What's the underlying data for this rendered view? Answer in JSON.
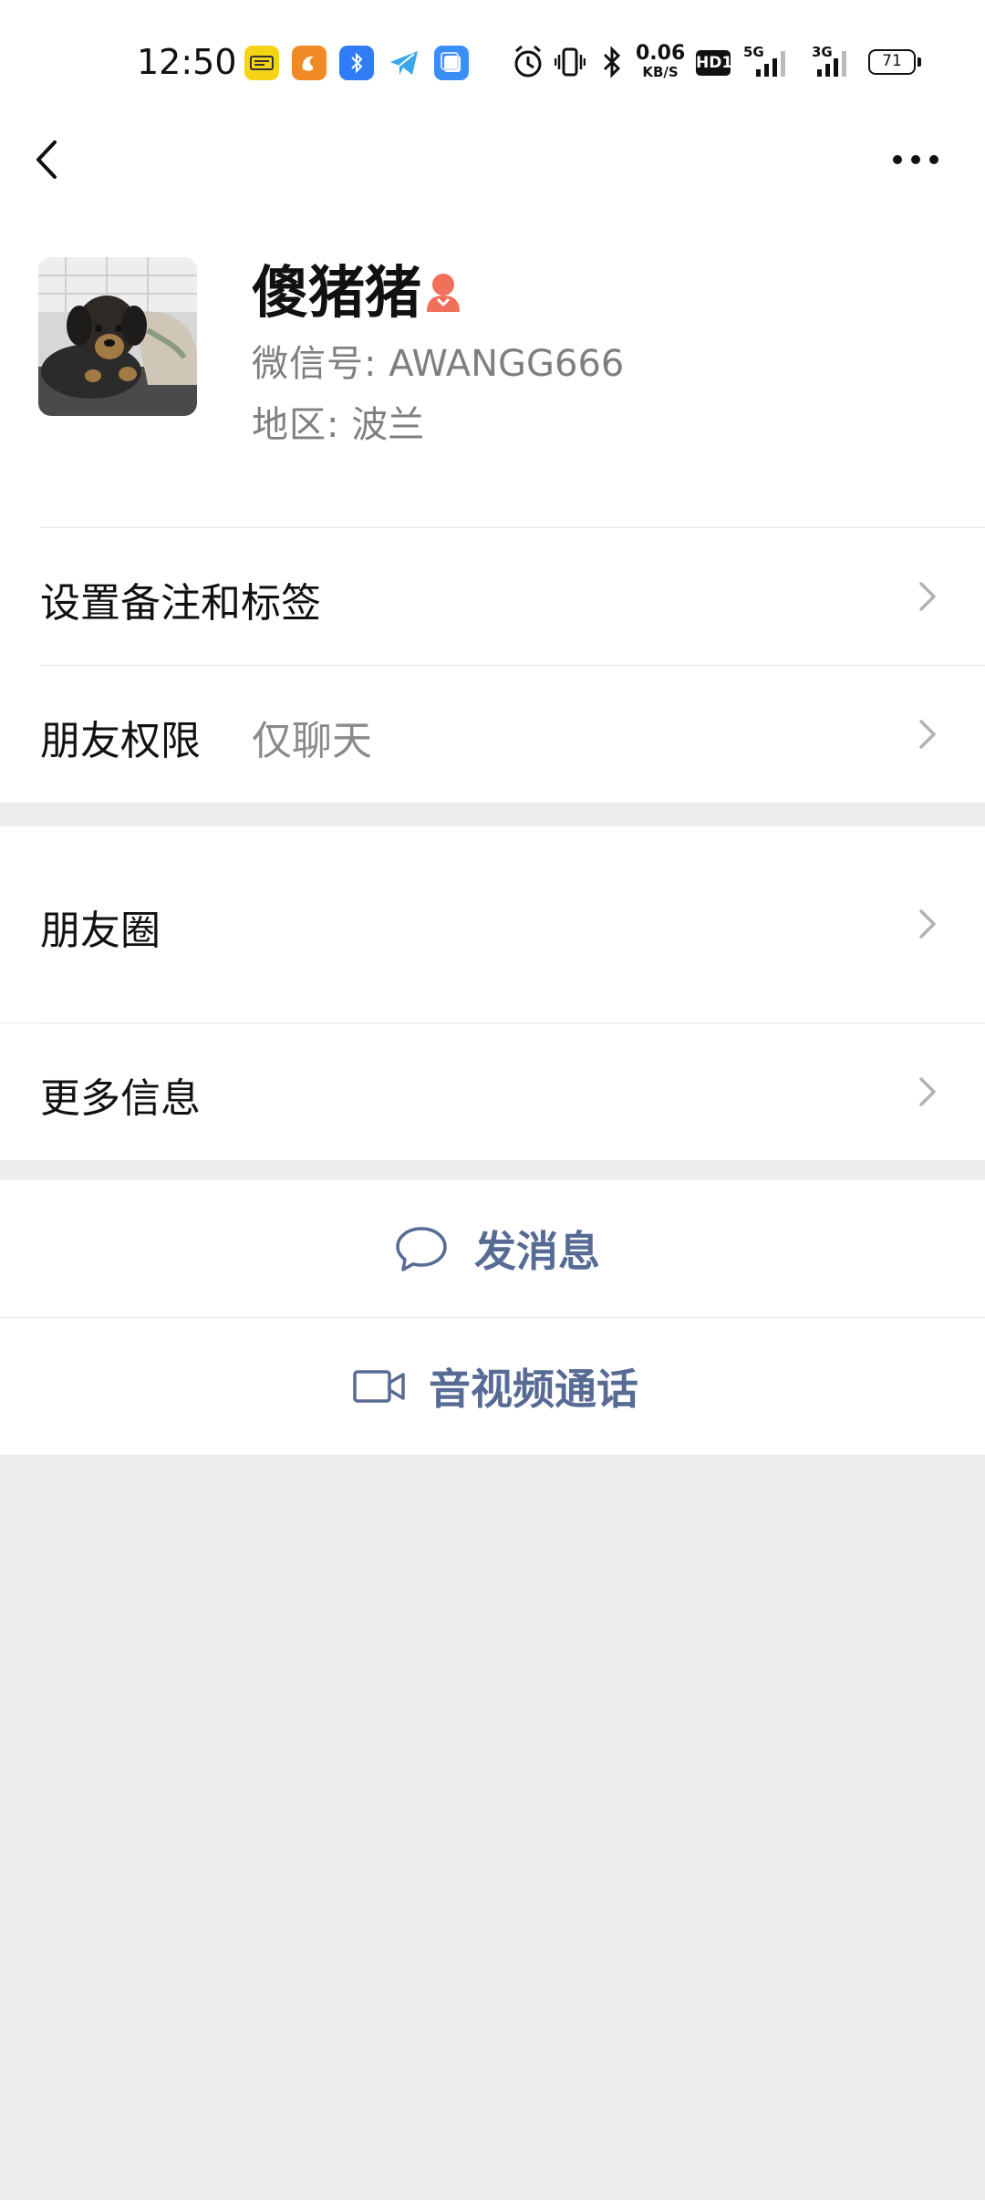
{
  "status_bar": {
    "time": "12:50",
    "net_speed_value": "0.06",
    "net_speed_unit": "KB/S",
    "hd_label": "HD1",
    "signal1_tag": "5G",
    "signal2_tag": "3G",
    "battery_level": "71",
    "app_icons": [
      "news-app-icon",
      "uc-browser-icon",
      "bluetooth-app-icon",
      "telegram-icon",
      "window-app-icon"
    ],
    "colors": {
      "news": "#f5d315",
      "uc": "#f08a24",
      "bt": "#2f7cf6",
      "telegram": "#37a7e8",
      "window": "#3a8ef6"
    }
  },
  "profile": {
    "name": "傻猪猪",
    "wechat_id_label": "微信号:",
    "wechat_id_value": "AWANGG666",
    "region_label": "地区:",
    "region_value": "波兰",
    "gender_color": "#f0705a"
  },
  "rows": {
    "remark_tags": {
      "label": "设置备注和标签"
    },
    "permissions": {
      "label": "朋友权限",
      "value": "仅聊天"
    },
    "moments": {
      "label": "朋友圈"
    },
    "more_info": {
      "label": "更多信息"
    }
  },
  "actions": {
    "message": {
      "label": "发消息"
    },
    "call": {
      "label": "音视频通话"
    },
    "accent_color": "#576b95"
  }
}
